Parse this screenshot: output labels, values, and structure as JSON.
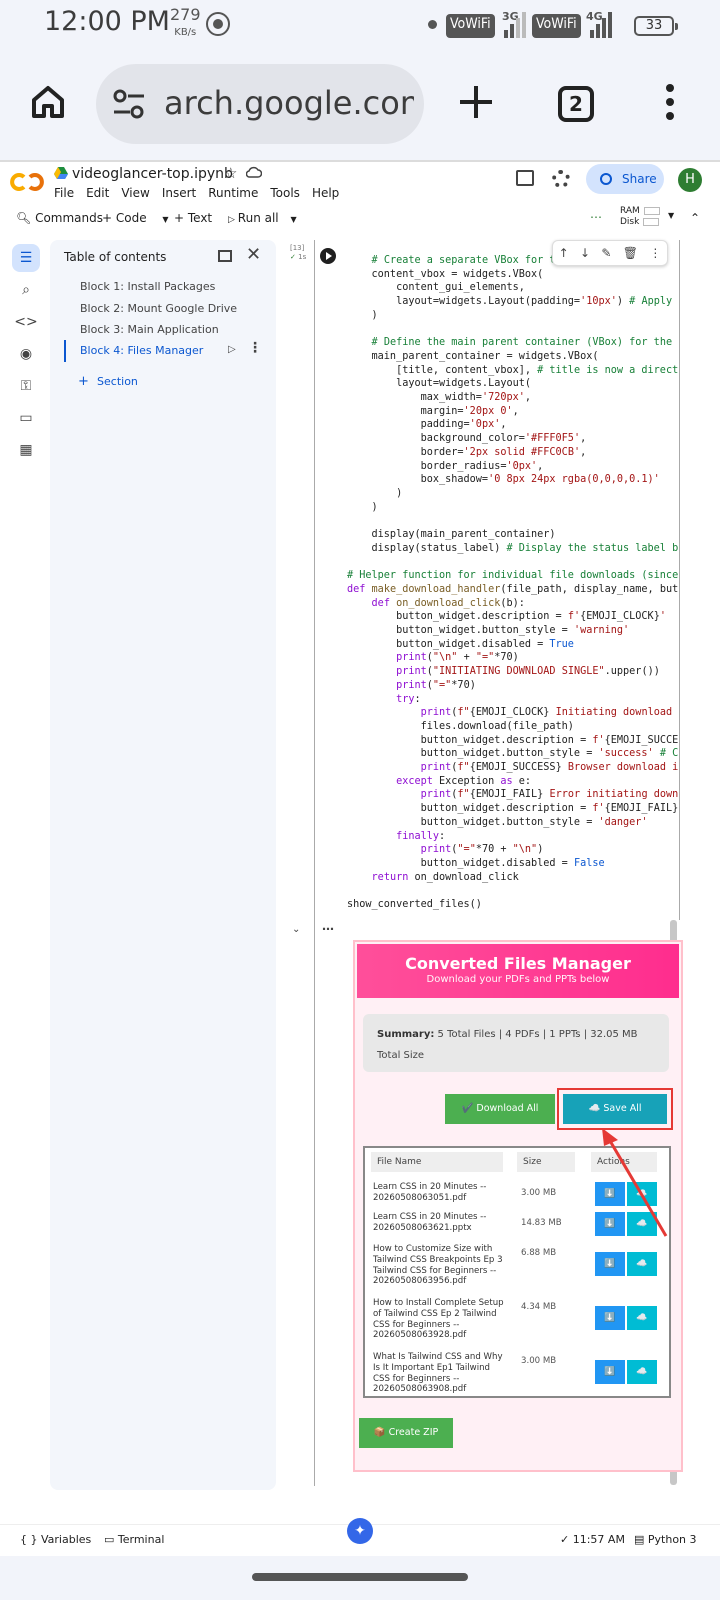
{
  "status_bar": {
    "time": "12:00 PM",
    "speed_value": "279",
    "speed_unit": "KB/s",
    "vowifi1": "VoWiFi",
    "net1": "3G",
    "vowifi2": "VoWiFi",
    "net2": "4G",
    "battery": "33"
  },
  "browser": {
    "url": "arch.google.com",
    "tab_count": "2"
  },
  "colab": {
    "notebook_title": "videoglancer-top.ipynb",
    "menu": [
      "File",
      "Edit",
      "View",
      "Insert",
      "Runtime",
      "Tools",
      "Help"
    ],
    "share_label": "Share",
    "avatar_letter": "H",
    "toolbar": {
      "commands": "Commands",
      "code": "+ Code",
      "text": "+ Text",
      "run_all": "Run all",
      "ram": "RAM",
      "disk": "Disk"
    }
  },
  "toc": {
    "title": "Table of contents",
    "items": [
      "Block 1: Install Packages",
      "Block 2: Mount Google Drive",
      "Block 3: Main Application",
      "Block 4: Files Manager"
    ],
    "active_index": 3,
    "add_section": "Section"
  },
  "cell": {
    "exec_count": "[13]",
    "exec_time": "1s"
  },
  "output": {
    "title": "Converted Files Manager",
    "subtitle": "Download your PDFs and PPTs below",
    "summary_label": "Summary:",
    "summary_text": "5 Total Files | 4 PDFs | 1 PPTs | 32.05 MB Total Size",
    "download_all": "✔️ Download All",
    "save_all": "☁️ Save All",
    "table_headers": [
      "File Name",
      "Size",
      "Actions"
    ],
    "files": [
      {
        "name": "Learn CSS in 20 Minutes -- 20260508063051.pdf",
        "size": "3.00 MB"
      },
      {
        "name": "Learn CSS in 20 Minutes -- 20260508063621.pptx",
        "size": "14.83 MB"
      },
      {
        "name": "How to Customize Size with Tailwind CSS Breakpoints Ep 3 Tailwind CSS for Beginners -- 20260508063956.pdf",
        "size": "6.88 MB"
      },
      {
        "name": "How to Install Complete Setup of Tailwind CSS Ep 2 Tailwind CSS for Beginners -- 20260508063928.pdf",
        "size": "4.34 MB"
      },
      {
        "name": "What Is Tailwind CSS and Why Is It Important Ep1 Tailwind CSS for Beginners -- 20260508063908.pdf",
        "size": "3.00 MB"
      }
    ],
    "create_zip": "📦 Create ZIP"
  },
  "bottom_bar": {
    "variables": "Variables",
    "terminal": "Terminal",
    "time": "11:57 AM",
    "runtime": "Python 3"
  },
  "colors": {
    "header_pink": "#ff2d8e",
    "download_green": "#4caf50",
    "save_teal": "#17a2b8",
    "highlight_red": "#e53935",
    "colab_blue": "#0b57d0"
  }
}
